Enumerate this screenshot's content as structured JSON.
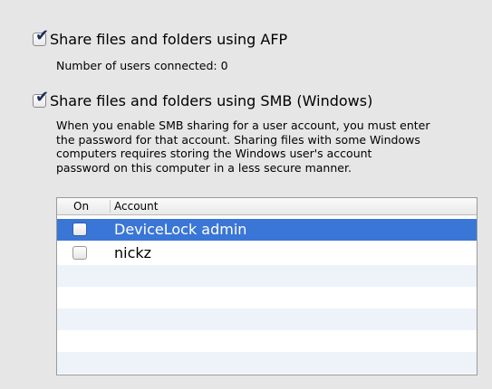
{
  "afp": {
    "checked": true,
    "label": "Share files and folders using AFP",
    "users_connected": "Number of users connected: 0"
  },
  "smb": {
    "checked": true,
    "label": "Share files and folders using SMB (Windows)",
    "description_lines": [
      "When you enable SMB sharing for a user account, you must enter",
      "the password for that account. Sharing files with some Windows",
      "computers requires storing the Windows user's account",
      "password on this computer in a less secure manner."
    ]
  },
  "accounts_table": {
    "columns": [
      "On",
      "Account"
    ],
    "rows": [
      {
        "on": false,
        "account": "DeviceLock admin",
        "selected": true
      },
      {
        "on": false,
        "account": "nickz",
        "selected": false
      }
    ]
  },
  "colors": {
    "selection": "#3a76d6",
    "alt_row": "#eef3fa",
    "background": "#e6e6e6"
  }
}
